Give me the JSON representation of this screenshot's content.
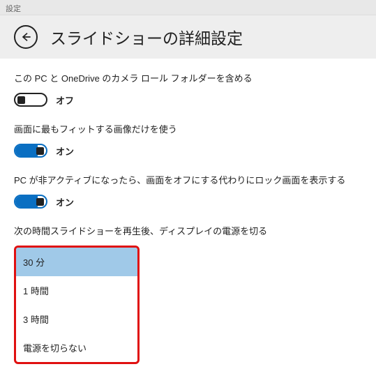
{
  "titlebar": "設定",
  "header": {
    "title": "スライドショーの詳細設定"
  },
  "settings": {
    "cameraRoll": {
      "label": "この PC と OneDrive のカメラ ロール フォルダーを含める",
      "state": "オフ",
      "on": false
    },
    "fitScreen": {
      "label": "画面に最もフィットする画像だけを使う",
      "state": "オン",
      "on": true
    },
    "inactive": {
      "label": "PC が非アクティブになったら、画面をオフにする代わりにロック画面を表示する",
      "state": "オン",
      "on": true
    },
    "powerOff": {
      "label": "次の時間スライドショーを再生後、ディスプレイの電源を切る",
      "options": [
        "30 分",
        "1 時間",
        "3 時間",
        "電源を切らない"
      ],
      "selectedIndex": 0
    }
  }
}
